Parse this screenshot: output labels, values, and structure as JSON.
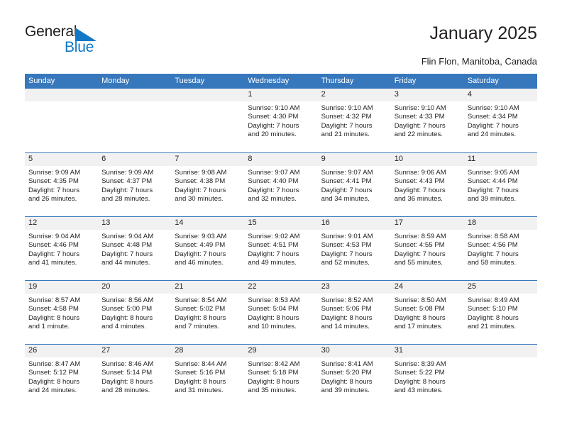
{
  "brand": {
    "name_dark": "General",
    "name_blue": "Blue",
    "triangle_color": "#1277c4",
    "accent_color": "#3778bd"
  },
  "header": {
    "title": "January 2025",
    "subtitle": "Flin Flon, Manitoba, Canada"
  },
  "weekday_headers": [
    "Sunday",
    "Monday",
    "Tuesday",
    "Wednesday",
    "Thursday",
    "Friday",
    "Saturday"
  ],
  "weeks": [
    [
      {
        "day": "",
        "sunrise": "",
        "sunset": "",
        "daylight1": "",
        "daylight2": ""
      },
      {
        "day": "",
        "sunrise": "",
        "sunset": "",
        "daylight1": "",
        "daylight2": ""
      },
      {
        "day": "",
        "sunrise": "",
        "sunset": "",
        "daylight1": "",
        "daylight2": ""
      },
      {
        "day": "1",
        "sunrise": "Sunrise: 9:10 AM",
        "sunset": "Sunset: 4:30 PM",
        "daylight1": "Daylight: 7 hours",
        "daylight2": "and 20 minutes."
      },
      {
        "day": "2",
        "sunrise": "Sunrise: 9:10 AM",
        "sunset": "Sunset: 4:32 PM",
        "daylight1": "Daylight: 7 hours",
        "daylight2": "and 21 minutes."
      },
      {
        "day": "3",
        "sunrise": "Sunrise: 9:10 AM",
        "sunset": "Sunset: 4:33 PM",
        "daylight1": "Daylight: 7 hours",
        "daylight2": "and 22 minutes."
      },
      {
        "day": "4",
        "sunrise": "Sunrise: 9:10 AM",
        "sunset": "Sunset: 4:34 PM",
        "daylight1": "Daylight: 7 hours",
        "daylight2": "and 24 minutes."
      }
    ],
    [
      {
        "day": "5",
        "sunrise": "Sunrise: 9:09 AM",
        "sunset": "Sunset: 4:35 PM",
        "daylight1": "Daylight: 7 hours",
        "daylight2": "and 26 minutes."
      },
      {
        "day": "6",
        "sunrise": "Sunrise: 9:09 AM",
        "sunset": "Sunset: 4:37 PM",
        "daylight1": "Daylight: 7 hours",
        "daylight2": "and 28 minutes."
      },
      {
        "day": "7",
        "sunrise": "Sunrise: 9:08 AM",
        "sunset": "Sunset: 4:38 PM",
        "daylight1": "Daylight: 7 hours",
        "daylight2": "and 30 minutes."
      },
      {
        "day": "8",
        "sunrise": "Sunrise: 9:07 AM",
        "sunset": "Sunset: 4:40 PM",
        "daylight1": "Daylight: 7 hours",
        "daylight2": "and 32 minutes."
      },
      {
        "day": "9",
        "sunrise": "Sunrise: 9:07 AM",
        "sunset": "Sunset: 4:41 PM",
        "daylight1": "Daylight: 7 hours",
        "daylight2": "and 34 minutes."
      },
      {
        "day": "10",
        "sunrise": "Sunrise: 9:06 AM",
        "sunset": "Sunset: 4:43 PM",
        "daylight1": "Daylight: 7 hours",
        "daylight2": "and 36 minutes."
      },
      {
        "day": "11",
        "sunrise": "Sunrise: 9:05 AM",
        "sunset": "Sunset: 4:44 PM",
        "daylight1": "Daylight: 7 hours",
        "daylight2": "and 39 minutes."
      }
    ],
    [
      {
        "day": "12",
        "sunrise": "Sunrise: 9:04 AM",
        "sunset": "Sunset: 4:46 PM",
        "daylight1": "Daylight: 7 hours",
        "daylight2": "and 41 minutes."
      },
      {
        "day": "13",
        "sunrise": "Sunrise: 9:04 AM",
        "sunset": "Sunset: 4:48 PM",
        "daylight1": "Daylight: 7 hours",
        "daylight2": "and 44 minutes."
      },
      {
        "day": "14",
        "sunrise": "Sunrise: 9:03 AM",
        "sunset": "Sunset: 4:49 PM",
        "daylight1": "Daylight: 7 hours",
        "daylight2": "and 46 minutes."
      },
      {
        "day": "15",
        "sunrise": "Sunrise: 9:02 AM",
        "sunset": "Sunset: 4:51 PM",
        "daylight1": "Daylight: 7 hours",
        "daylight2": "and 49 minutes."
      },
      {
        "day": "16",
        "sunrise": "Sunrise: 9:01 AM",
        "sunset": "Sunset: 4:53 PM",
        "daylight1": "Daylight: 7 hours",
        "daylight2": "and 52 minutes."
      },
      {
        "day": "17",
        "sunrise": "Sunrise: 8:59 AM",
        "sunset": "Sunset: 4:55 PM",
        "daylight1": "Daylight: 7 hours",
        "daylight2": "and 55 minutes."
      },
      {
        "day": "18",
        "sunrise": "Sunrise: 8:58 AM",
        "sunset": "Sunset: 4:56 PM",
        "daylight1": "Daylight: 7 hours",
        "daylight2": "and 58 minutes."
      }
    ],
    [
      {
        "day": "19",
        "sunrise": "Sunrise: 8:57 AM",
        "sunset": "Sunset: 4:58 PM",
        "daylight1": "Daylight: 8 hours",
        "daylight2": "and 1 minute."
      },
      {
        "day": "20",
        "sunrise": "Sunrise: 8:56 AM",
        "sunset": "Sunset: 5:00 PM",
        "daylight1": "Daylight: 8 hours",
        "daylight2": "and 4 minutes."
      },
      {
        "day": "21",
        "sunrise": "Sunrise: 8:54 AM",
        "sunset": "Sunset: 5:02 PM",
        "daylight1": "Daylight: 8 hours",
        "daylight2": "and 7 minutes."
      },
      {
        "day": "22",
        "sunrise": "Sunrise: 8:53 AM",
        "sunset": "Sunset: 5:04 PM",
        "daylight1": "Daylight: 8 hours",
        "daylight2": "and 10 minutes."
      },
      {
        "day": "23",
        "sunrise": "Sunrise: 8:52 AM",
        "sunset": "Sunset: 5:06 PM",
        "daylight1": "Daylight: 8 hours",
        "daylight2": "and 14 minutes."
      },
      {
        "day": "24",
        "sunrise": "Sunrise: 8:50 AM",
        "sunset": "Sunset: 5:08 PM",
        "daylight1": "Daylight: 8 hours",
        "daylight2": "and 17 minutes."
      },
      {
        "day": "25",
        "sunrise": "Sunrise: 8:49 AM",
        "sunset": "Sunset: 5:10 PM",
        "daylight1": "Daylight: 8 hours",
        "daylight2": "and 21 minutes."
      }
    ],
    [
      {
        "day": "26",
        "sunrise": "Sunrise: 8:47 AM",
        "sunset": "Sunset: 5:12 PM",
        "daylight1": "Daylight: 8 hours",
        "daylight2": "and 24 minutes."
      },
      {
        "day": "27",
        "sunrise": "Sunrise: 8:46 AM",
        "sunset": "Sunset: 5:14 PM",
        "daylight1": "Daylight: 8 hours",
        "daylight2": "and 28 minutes."
      },
      {
        "day": "28",
        "sunrise": "Sunrise: 8:44 AM",
        "sunset": "Sunset: 5:16 PM",
        "daylight1": "Daylight: 8 hours",
        "daylight2": "and 31 minutes."
      },
      {
        "day": "29",
        "sunrise": "Sunrise: 8:42 AM",
        "sunset": "Sunset: 5:18 PM",
        "daylight1": "Daylight: 8 hours",
        "daylight2": "and 35 minutes."
      },
      {
        "day": "30",
        "sunrise": "Sunrise: 8:41 AM",
        "sunset": "Sunset: 5:20 PM",
        "daylight1": "Daylight: 8 hours",
        "daylight2": "and 39 minutes."
      },
      {
        "day": "31",
        "sunrise": "Sunrise: 8:39 AM",
        "sunset": "Sunset: 5:22 PM",
        "daylight1": "Daylight: 8 hours",
        "daylight2": "and 43 minutes."
      },
      {
        "day": "",
        "sunrise": "",
        "sunset": "",
        "daylight1": "",
        "daylight2": ""
      }
    ]
  ]
}
